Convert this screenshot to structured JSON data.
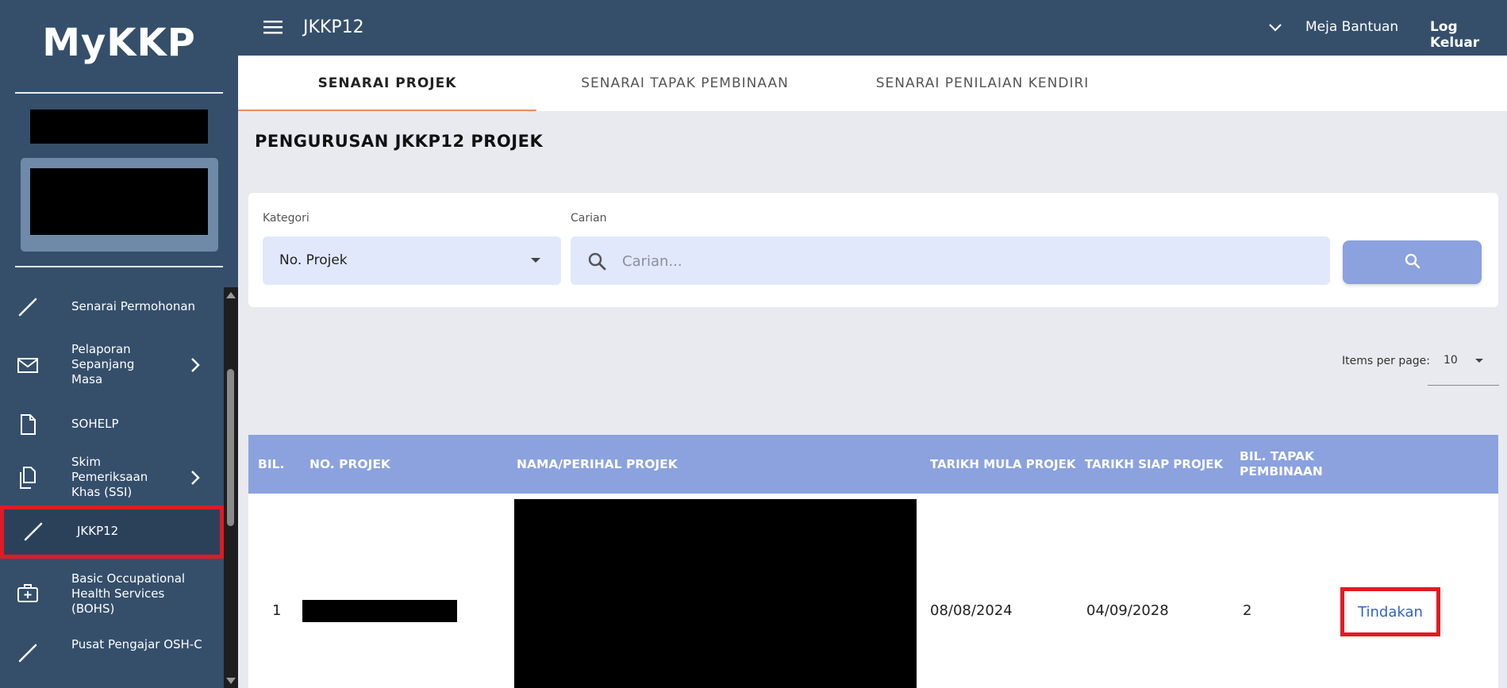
{
  "app": {
    "logo": "MyKKP"
  },
  "sidebar": {
    "items": [
      {
        "label": "Senarai Permohonan",
        "icon": "pencil-icon",
        "has_submenu": false
      },
      {
        "label": "Pelaporan Sepanjang Masa",
        "icon": "envelope-icon",
        "has_submenu": true
      },
      {
        "label": "SOHELP",
        "icon": "document-icon",
        "has_submenu": false
      },
      {
        "label": "Skim Pemeriksaan Khas (SSI)",
        "icon": "documents-icon",
        "has_submenu": true
      },
      {
        "label": "JKKP12",
        "icon": "pencil-icon",
        "has_submenu": false,
        "active": true
      },
      {
        "label": "Basic Occupational Health Services (BOHS)",
        "icon": "medical-kit-icon",
        "has_submenu": false
      },
      {
        "label": "Pusat Pengajar OSH-C",
        "icon": "pencil-icon",
        "has_submenu": false
      }
    ]
  },
  "topbar": {
    "title": "JKKP12",
    "help_label": "Meja Bantuan",
    "logout_label": "Log Keluar"
  },
  "tabs": [
    {
      "label": "SENARAI PROJEK",
      "active": true
    },
    {
      "label": "SENARAI TAPAK PEMBINAAN",
      "active": false
    },
    {
      "label": "SENARAI PENILAIAN KENDIRI",
      "active": false
    }
  ],
  "page": {
    "title": "PENGURUSAN JKKP12 PROJEK"
  },
  "filter": {
    "category_label": "Kategori",
    "category_value": "No. Projek",
    "search_label": "Carian",
    "search_placeholder": "Carian...",
    "search_value": ""
  },
  "pagination": {
    "items_per_page_label": "Items per page:",
    "items_per_page_value": "10"
  },
  "table": {
    "headers": [
      "BIL.",
      "NO. PROJEK",
      "NAMA/PERIHAL PROJEK",
      "TARIKH MULA PROJEK",
      "TARIKH SIAP PROJEK",
      "BIL. TAPAK PEMBINAAN",
      ""
    ],
    "rows": [
      {
        "bil": "1",
        "start_date": "08/08/2024",
        "end_date": "04/09/2028",
        "site_count": "2",
        "action": "Tindakan"
      }
    ]
  },
  "colors": {
    "sidebar_bg": "#354f6b",
    "accent_blue": "#8ba2df",
    "highlight_red": "#e01b24",
    "tab_underline": "#f08a5d",
    "link_blue": "#2f64c8"
  }
}
